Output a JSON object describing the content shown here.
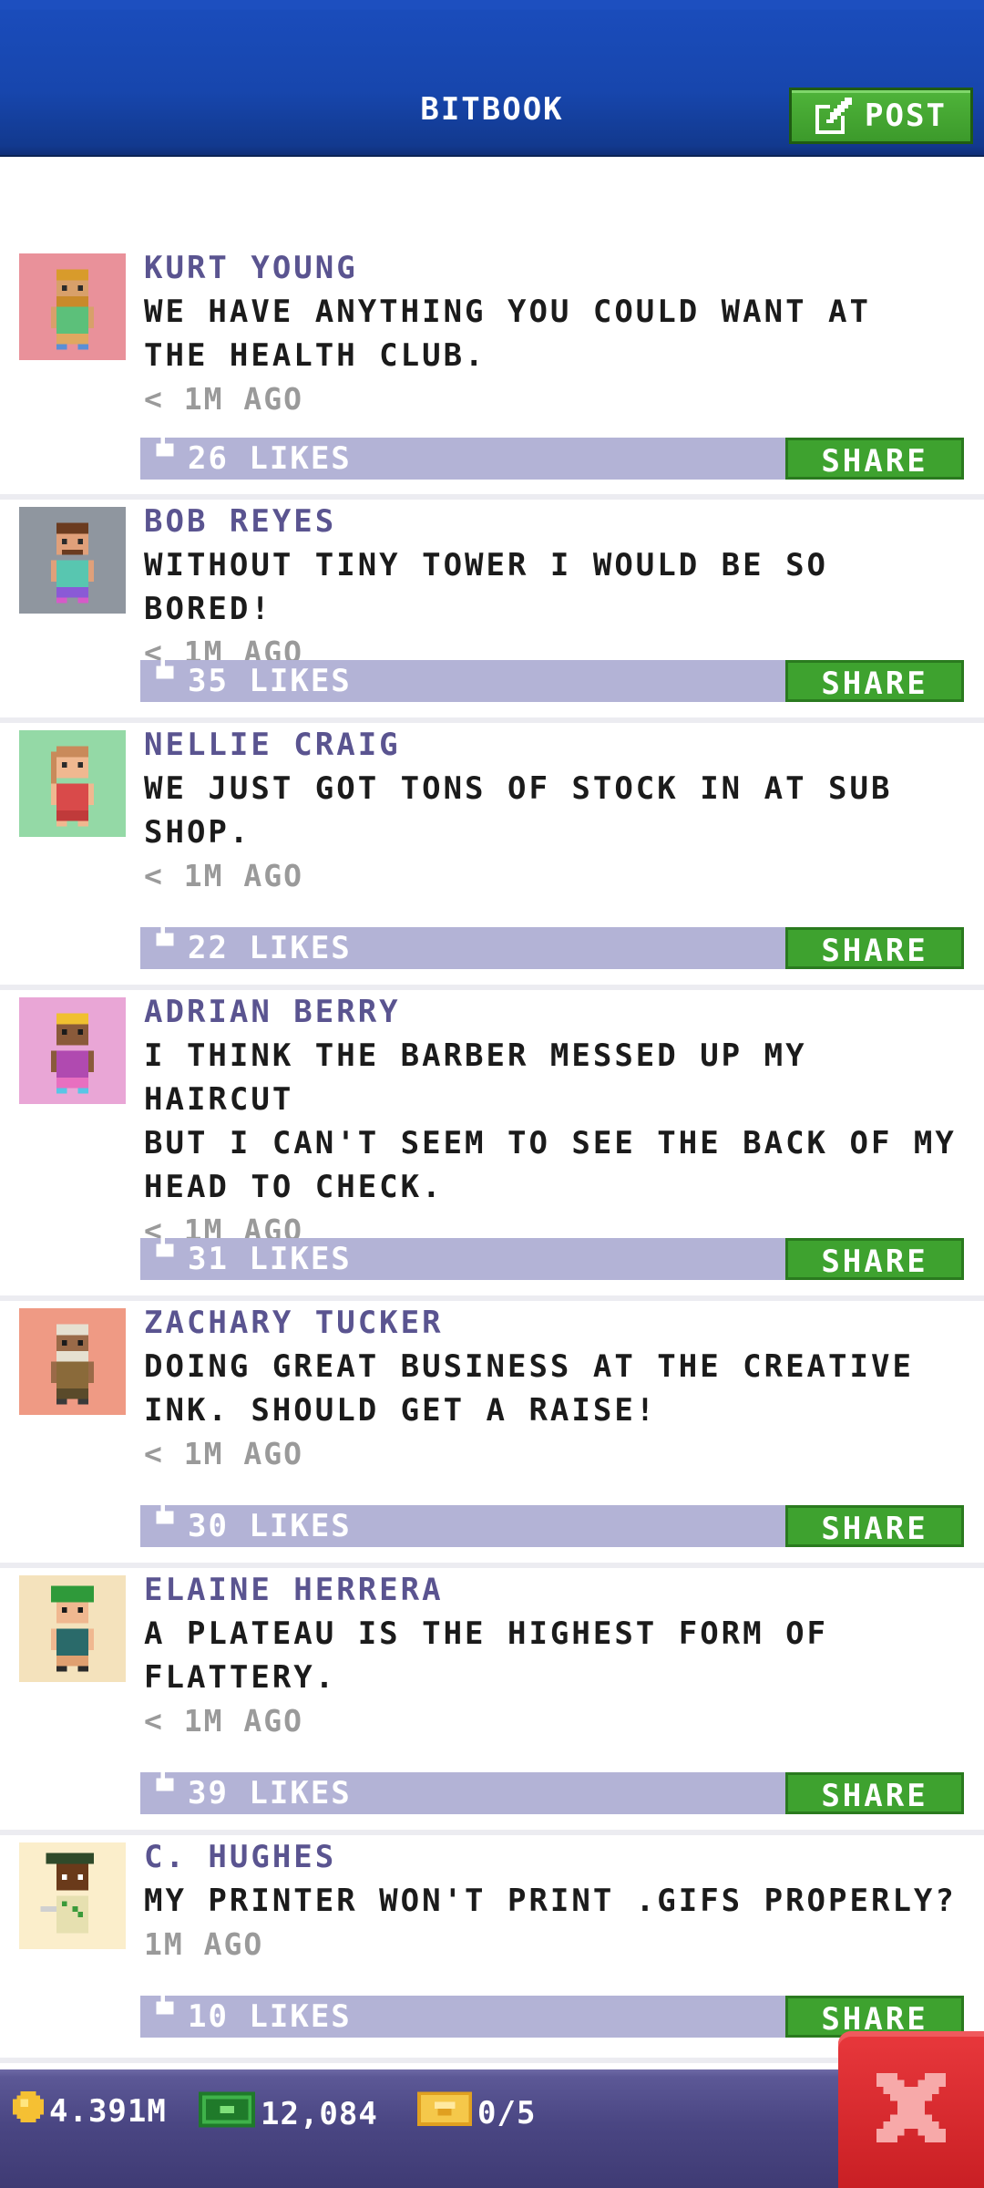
{
  "header": {
    "title": "BITBOOK",
    "post_label": "POST"
  },
  "posts": [
    {
      "author": "KURT YOUNG",
      "message": "WE HAVE ANYTHING YOU COULD WANT AT\nTHE HEALTH CLUB.",
      "time": "< 1M AGO",
      "likes": "26 LIKES",
      "share": "SHARE",
      "avatar_bg": "#e9919a"
    },
    {
      "author": "BOB REYES",
      "message": "WITHOUT TINY TOWER I WOULD BE SO BORED!",
      "time": "< 1M AGO",
      "likes": "35 LIKES",
      "share": "SHARE",
      "avatar_bg": "#8f969f"
    },
    {
      "author": "NELLIE CRAIG",
      "message": "WE JUST GOT TONS OF STOCK IN AT SUB\nSHOP.",
      "time": "< 1M AGO",
      "likes": "22 LIKES",
      "share": "SHARE",
      "avatar_bg": "#94d9a6"
    },
    {
      "author": "ADRIAN BERRY",
      "message": "I THINK THE BARBER MESSED UP MY HAIRCUT\nBUT I CAN'T SEEM TO SEE THE BACK OF MY\nHEAD TO CHECK.",
      "time": "< 1M AGO",
      "likes": "31 LIKES",
      "share": "SHARE",
      "avatar_bg": "#e9a6d6"
    },
    {
      "author": "ZACHARY TUCKER",
      "message": "DOING GREAT BUSINESS AT THE CREATIVE\nINK. SHOULD GET A RAISE!",
      "time": "< 1M AGO",
      "likes": "30 LIKES",
      "share": "SHARE",
      "avatar_bg": "#ef9a84"
    },
    {
      "author": "ELAINE HERRERA",
      "message": "A PLATEAU IS THE HIGHEST FORM OF\nFLATTERY.",
      "time": "< 1M AGO",
      "likes": "39 LIKES",
      "share": "SHARE",
      "avatar_bg": "#f4e2bc"
    },
    {
      "author": "C. HUGHES",
      "message": "MY PRINTER WON'T PRINT .GIFS PROPERLY?",
      "time": "1M AGO",
      "likes": "10 LIKES",
      "share": "SHARE",
      "avatar_bg": "#fbeecb"
    }
  ],
  "status": {
    "coins": "4.391M",
    "bux": "12,084",
    "tickets": "0/5"
  },
  "colors": {
    "header_blue": "#1746ad",
    "share_green": "#3ea22f",
    "likes_bar": "#b3b3d6",
    "author": "#5a5490",
    "close_red": "#d9272c"
  }
}
